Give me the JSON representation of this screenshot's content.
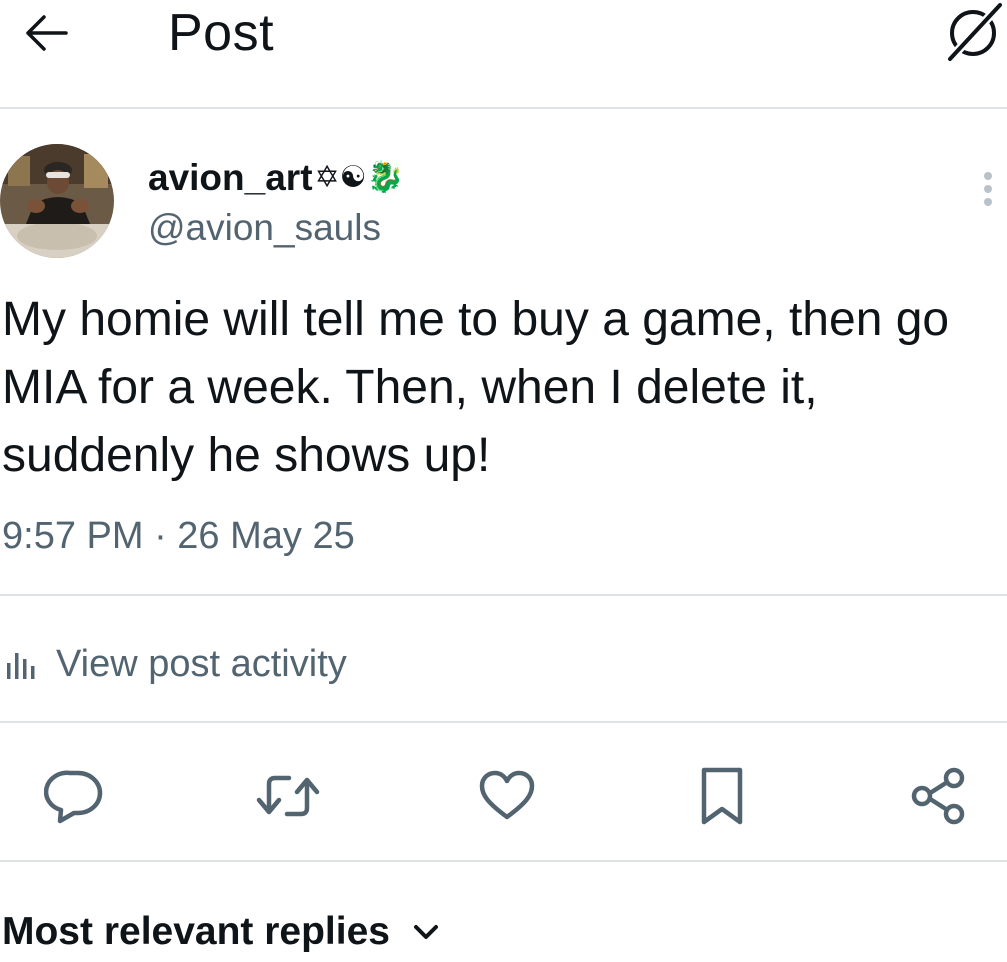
{
  "header": {
    "title": "Post",
    "back_icon": "arrow-left-icon",
    "grok_icon": "grok-icon"
  },
  "post": {
    "author": {
      "display_name": "avion_art",
      "name_emojis": "✡☯🐉",
      "handle": "@avion_sauls"
    },
    "text": "My homie will tell me to buy a game, then go MIA for a week. Then, when I delete it, suddenly he shows up!",
    "timestamp": "9:57 PM · 26 May 25",
    "more_icon": "more-vertical-icon"
  },
  "activity": {
    "label": "View post activity",
    "icon": "bar-chart-icon"
  },
  "actions": [
    {
      "name": "reply",
      "icon": "reply-icon"
    },
    {
      "name": "repost",
      "icon": "repost-icon"
    },
    {
      "name": "like",
      "icon": "heart-icon"
    },
    {
      "name": "bookmark",
      "icon": "bookmark-icon"
    },
    {
      "name": "share",
      "icon": "share-icon"
    }
  ],
  "replies": {
    "label": "Most relevant replies",
    "icon": "chevron-down-icon"
  },
  "colors": {
    "text": "#0f1419",
    "secondary": "#536471",
    "divider": "#dfe3e6"
  }
}
